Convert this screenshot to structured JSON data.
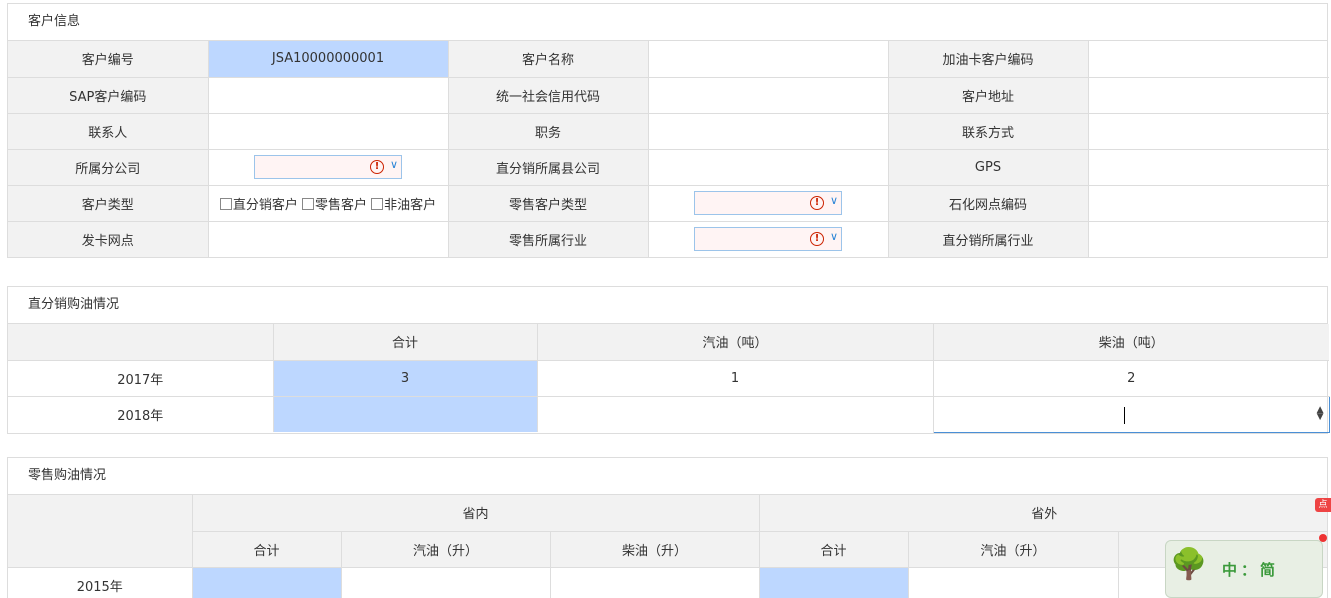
{
  "customer_info": {
    "title": "客户信息",
    "rows": [
      [
        {
          "label": "客户编号",
          "value": "JSA10000000001",
          "highlight": true
        },
        {
          "label": "客户名称",
          "value": ""
        },
        {
          "label": "加油卡客户编码",
          "value": ""
        }
      ],
      [
        {
          "label": "SAP客户编码",
          "value": ""
        },
        {
          "label": "统一社会信用代码",
          "value": ""
        },
        {
          "label": "客户地址",
          "value": ""
        }
      ],
      [
        {
          "label": "联系人",
          "value": ""
        },
        {
          "label": "职务",
          "value": ""
        },
        {
          "label": "联系方式",
          "value": ""
        }
      ],
      [
        {
          "label": "所属分公司",
          "select": true
        },
        {
          "label": "直分销所属县公司",
          "value": ""
        },
        {
          "label": "GPS",
          "value": ""
        }
      ],
      [
        {
          "label": "客户类型",
          "checkboxes": [
            "直分销客户",
            "零售客户",
            "非油客户"
          ]
        },
        {
          "label": "零售客户类型",
          "select": true
        },
        {
          "label": "石化网点编码",
          "value": ""
        }
      ],
      [
        {
          "label": "发卡网点",
          "value": ""
        },
        {
          "label": "零售所属行业",
          "select": true
        },
        {
          "label": "直分销所属行业",
          "value": ""
        }
      ]
    ]
  },
  "direct_purchase": {
    "title": "直分销购油情况",
    "headers": [
      "",
      "合计",
      "汽油（吨）",
      "柴油（吨）"
    ],
    "rows": [
      {
        "year": "2017年",
        "total": "3",
        "gasoline": "1",
        "diesel": "2"
      },
      {
        "year": "2018年",
        "total": "",
        "gasoline": "",
        "diesel": ""
      }
    ]
  },
  "retail_purchase": {
    "title": "零售购油情况",
    "group_headers": [
      "省内",
      "省外"
    ],
    "sub_headers": [
      "合计",
      "汽油（升）",
      "柴油（升）",
      "合计",
      "汽油（升）"
    ],
    "rows": [
      {
        "year": "2015年"
      }
    ]
  },
  "widget": {
    "text": "中：简"
  },
  "colors": {
    "highlight": "#bdd7ff",
    "label_bg": "#f2f2f2",
    "border": "#dddddd"
  }
}
